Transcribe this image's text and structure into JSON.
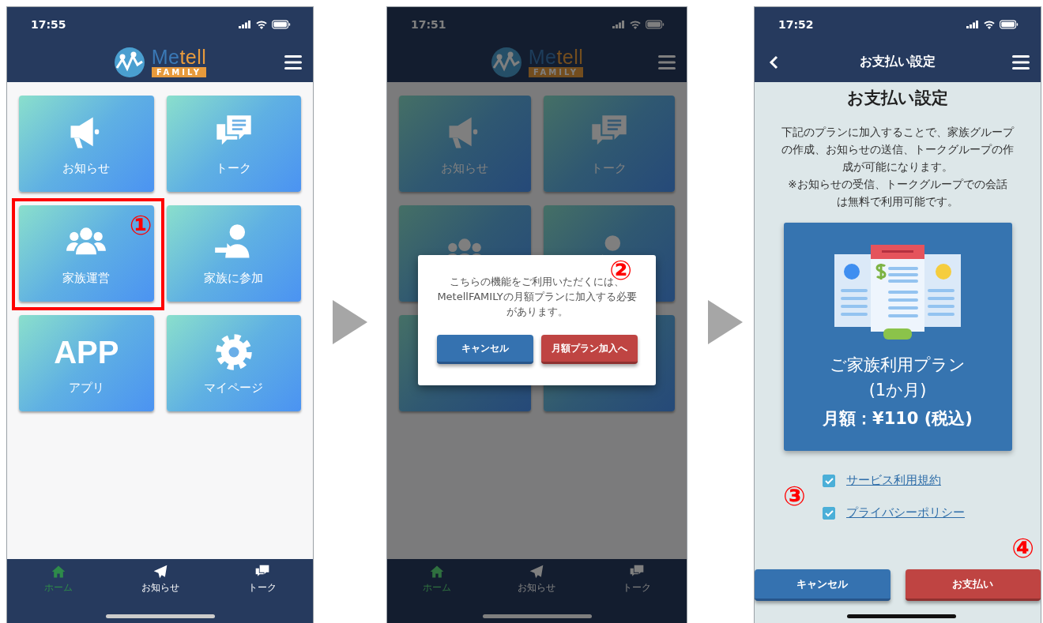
{
  "screens": [
    {
      "kind": "home",
      "time": "17:55",
      "dimmed": false,
      "logo": {
        "wordmark": [
          "Me",
          "tell"
        ],
        "badge": "FAMILY"
      },
      "tiles": [
        {
          "kind": "megaphone",
          "label": "お知らせ",
          "highlighted": false
        },
        {
          "kind": "chat",
          "label": "トーク",
          "highlighted": false
        },
        {
          "kind": "people",
          "label": "家族運営",
          "highlighted": true,
          "annotation": "①"
        },
        {
          "kind": "join",
          "label": "家族に参加",
          "highlighted": false
        },
        {
          "kind": "text",
          "glyph": "APP",
          "label": "アプリ",
          "highlighted": false
        },
        {
          "kind": "gear",
          "label": "マイページ",
          "highlighted": false
        }
      ],
      "nav": [
        {
          "kind": "home",
          "label": "ホーム",
          "selected": true
        },
        {
          "kind": "plane",
          "label": "お知らせ",
          "selected": false
        },
        {
          "kind": "chat",
          "label": "トーク",
          "selected": false
        }
      ]
    },
    {
      "kind": "home",
      "time": "17:51",
      "dimmed": true,
      "logo": {
        "wordmark": [
          "Me",
          "tell"
        ],
        "badge": "FAMILY"
      },
      "tiles": [
        {
          "kind": "megaphone",
          "label": "お知らせ"
        },
        {
          "kind": "chat",
          "label": "トーク"
        },
        {
          "kind": "people"
        },
        {
          "kind": "join"
        },
        {
          "kind": "blank"
        },
        {
          "kind": "blank"
        }
      ],
      "dialog": {
        "message": "こちらの機能をご利用いただくには、MetellFAMILYの月額プランに加入する必要があります。",
        "annotation": "②",
        "buttons": [
          {
            "kind": "cancel",
            "label": "キャンセル"
          },
          {
            "kind": "danger",
            "label": "月額プラン加入へ"
          }
        ]
      },
      "nav": [
        {
          "kind": "home",
          "label": "ホーム",
          "selected": true
        },
        {
          "kind": "plane",
          "label": "お知らせ",
          "selected": false
        },
        {
          "kind": "chat",
          "label": "トーク",
          "selected": false
        }
      ]
    },
    {
      "kind": "payment",
      "time": "17:52",
      "header_title": "お支払い設定",
      "heading": "お支払い設定",
      "description": "下記のプランに加入することで、家族グループの作成、お知らせの送信、トークグループの作成が可能になります。",
      "note": "※お知らせの受信、トークグループでの会話は無料で利用可能です。",
      "plan": {
        "name": "ご家族利用プラン",
        "period": "(1か月)",
        "price": "月額：¥110 (税込)"
      },
      "agreements_annotation": "③",
      "agreements": [
        {
          "label": "サービス利用規約",
          "checked": true
        },
        {
          "label": "プライバシーポリシー",
          "checked": true
        }
      ],
      "buttons": [
        {
          "kind": "cancel",
          "label": "キャンセル"
        },
        {
          "kind": "danger",
          "label": "お支払い",
          "annotation": "④"
        }
      ]
    }
  ]
}
